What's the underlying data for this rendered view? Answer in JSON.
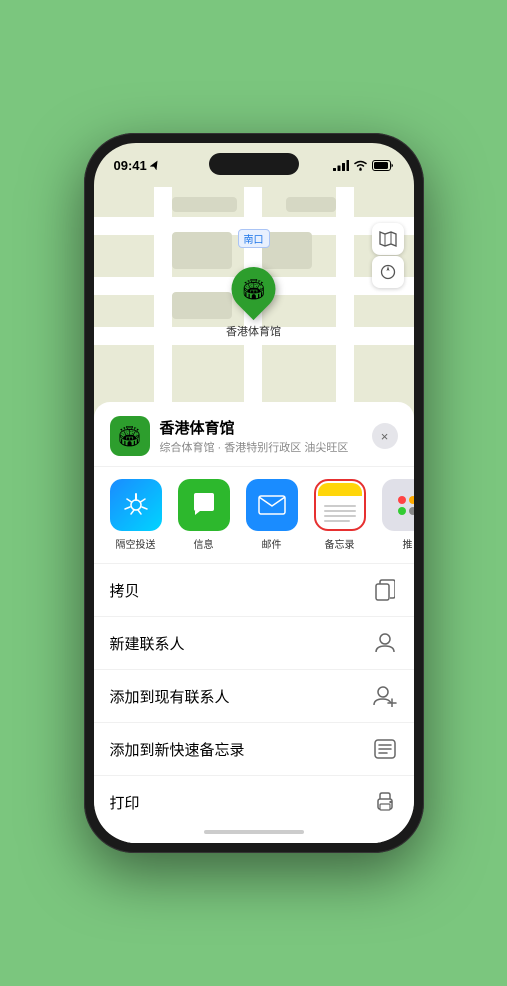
{
  "status": {
    "time": "09:41",
    "location_arrow": "▶"
  },
  "map": {
    "label": "南口",
    "controls": {
      "map_icon": "🗺",
      "location_icon": "⌖"
    }
  },
  "marker": {
    "label": "香港体育馆"
  },
  "sheet": {
    "venue_name": "香港体育馆",
    "venue_subtitle": "综合体育馆 · 香港特别行政区 油尖旺区",
    "close_label": "×"
  },
  "share_items": [
    {
      "id": "airdrop",
      "label": "隔空投送"
    },
    {
      "id": "messages",
      "label": "信息"
    },
    {
      "id": "mail",
      "label": "邮件"
    },
    {
      "id": "notes",
      "label": "备忘录"
    },
    {
      "id": "more",
      "label": "推"
    }
  ],
  "actions": [
    {
      "id": "copy",
      "label": "拷贝",
      "icon": "⎘"
    },
    {
      "id": "new-contact",
      "label": "新建联系人",
      "icon": "👤"
    },
    {
      "id": "add-contact",
      "label": "添加到现有联系人",
      "icon": "👤"
    },
    {
      "id": "quick-note",
      "label": "添加到新快速备忘录",
      "icon": "⊞"
    },
    {
      "id": "print",
      "label": "打印",
      "icon": "⎙"
    }
  ]
}
